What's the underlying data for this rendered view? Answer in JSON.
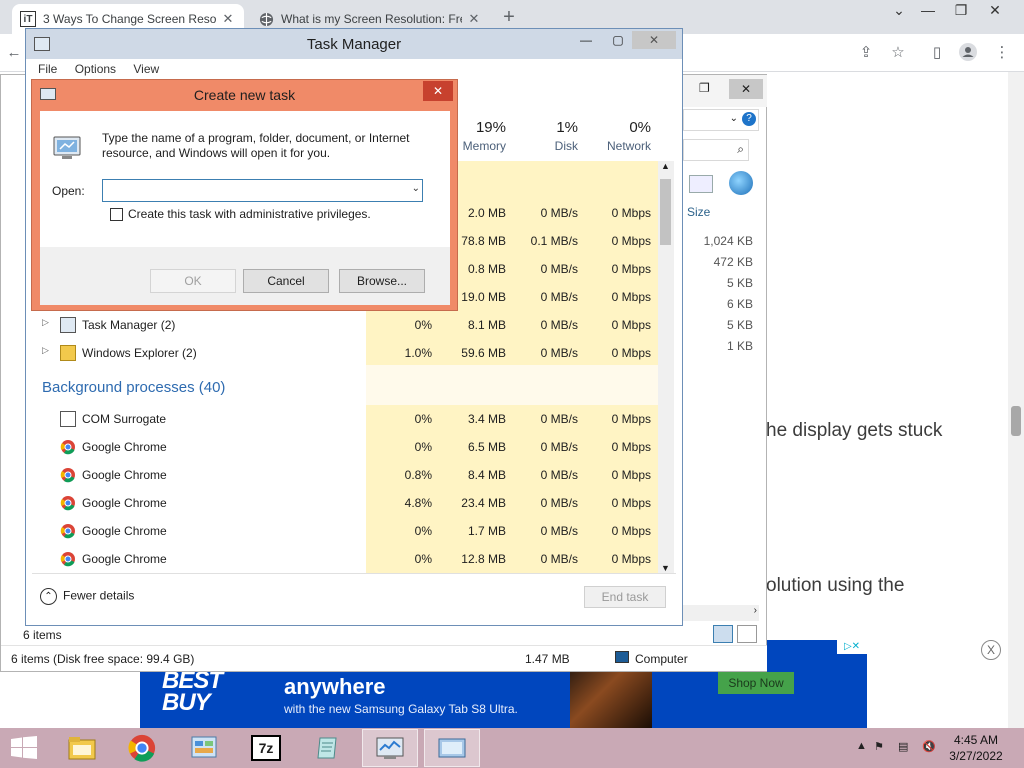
{
  "browser": {
    "tabs": [
      {
        "title": "3 Ways To Change Screen Resolu",
        "favicon": "iT",
        "active": true
      },
      {
        "title": "What is my Screen Resolution: Fre",
        "favicon": "globe-icon",
        "active": false
      }
    ],
    "page_text": {
      "line1": "he display gets stuck",
      "line2": "olution using the"
    },
    "ad": {
      "logo": "BEST BUY",
      "headline": "anywhere",
      "sub": "with the new Samsung Galaxy Tab S8 Ultra.",
      "cta": "Shop Now"
    }
  },
  "explorer": {
    "column_size": "Size",
    "sizes": [
      "1,024 KB",
      "472 KB",
      "5 KB",
      "6 KB",
      "5 KB",
      "1 KB"
    ],
    "items_count": "6 items",
    "status_left": "6 items (Disk free space: 99.4 GB)",
    "status_mid": "1.47 MB",
    "status_right": "Computer"
  },
  "taskmanager": {
    "title": "Task Manager",
    "menu": [
      "File",
      "Options",
      "View"
    ],
    "headers": [
      {
        "pct": "19%",
        "label": "Memory"
      },
      {
        "pct": "1%",
        "label": "Disk"
      },
      {
        "pct": "0%",
        "label": "Network"
      }
    ],
    "top_rows": [
      {
        "mem": "2.0 MB",
        "disk": "0 MB/s",
        "net": "0 Mbps"
      },
      {
        "mem": "78.8 MB",
        "disk": "0.1 MB/s",
        "net": "0 Mbps"
      },
      {
        "mem": "0.8 MB",
        "disk": "0 MB/s",
        "net": "0 Mbps"
      },
      {
        "mem": "19.0 MB",
        "disk": "0 MB/s",
        "net": "0 Mbps"
      }
    ],
    "apps": [
      {
        "name": "Task Manager (2)",
        "cpu": "0%",
        "mem": "8.1 MB",
        "disk": "0 MB/s",
        "net": "0 Mbps"
      },
      {
        "name": "Windows Explorer (2)",
        "cpu": "1.0%",
        "mem": "59.6 MB",
        "disk": "0 MB/s",
        "net": "0 Mbps"
      }
    ],
    "background_title": "Background processes (40)",
    "background": [
      {
        "name": "COM Surrogate",
        "cpu": "0%",
        "mem": "3.4 MB",
        "disk": "0 MB/s",
        "net": "0 Mbps"
      },
      {
        "name": "Google Chrome",
        "cpu": "0%",
        "mem": "6.5 MB",
        "disk": "0 MB/s",
        "net": "0 Mbps"
      },
      {
        "name": "Google Chrome",
        "cpu": "0.8%",
        "mem": "8.4 MB",
        "disk": "0 MB/s",
        "net": "0 Mbps"
      },
      {
        "name": "Google Chrome",
        "cpu": "4.8%",
        "mem": "23.4 MB",
        "disk": "0 MB/s",
        "net": "0 Mbps"
      },
      {
        "name": "Google Chrome",
        "cpu": "0%",
        "mem": "1.7 MB",
        "disk": "0 MB/s",
        "net": "0 Mbps"
      },
      {
        "name": "Google Chrome",
        "cpu": "0%",
        "mem": "12.8 MB",
        "disk": "0 MB/s",
        "net": "0 Mbps"
      }
    ],
    "fewer_details": "Fewer details",
    "end_task": "End task"
  },
  "dialog": {
    "title": "Create new task",
    "message": "Type the name of a program, folder, document, or Internet resource, and Windows will open it for you.",
    "open_label": "Open:",
    "open_value": "",
    "admin_label": "Create this task with administrative privileges.",
    "ok": "OK",
    "cancel": "Cancel",
    "browse": "Browse..."
  },
  "taskbar": {
    "time": "4:45 AM",
    "date": "3/27/2022",
    "apps": [
      "file-explorer-icon",
      "chrome-icon",
      "control-panel-icon",
      "7zip-icon",
      "notepad-icon",
      "task-manager-icon",
      "run-dialog-icon"
    ]
  }
}
